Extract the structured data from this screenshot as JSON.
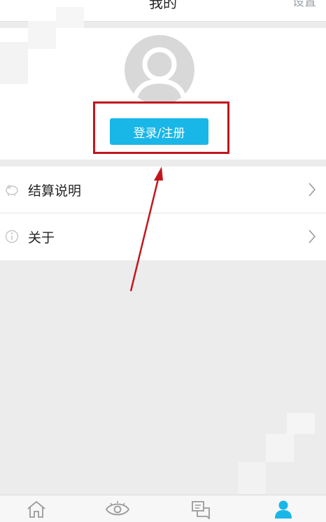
{
  "header": {
    "title": "我的",
    "settings_label": "设置"
  },
  "profile": {
    "avatar_icon": "user-avatar-placeholder",
    "login_button_label": "登录/注册"
  },
  "menu": [
    {
      "label": "结算说明",
      "icon": "piggy-bank-icon"
    },
    {
      "label": "关于",
      "icon": "info-icon"
    }
  ],
  "tabbar": {
    "tabs": [
      {
        "icon": "home-icon",
        "active": false
      },
      {
        "icon": "eye-icon",
        "active": false
      },
      {
        "icon": "chat-icon",
        "active": false
      },
      {
        "icon": "user-icon",
        "active": true
      }
    ],
    "active_color": "#19b6e8",
    "inactive_color": "#9a9a9a"
  },
  "colors": {
    "accent": "#19b6e8",
    "annotation": "#c3161c",
    "background": "#ececec"
  }
}
